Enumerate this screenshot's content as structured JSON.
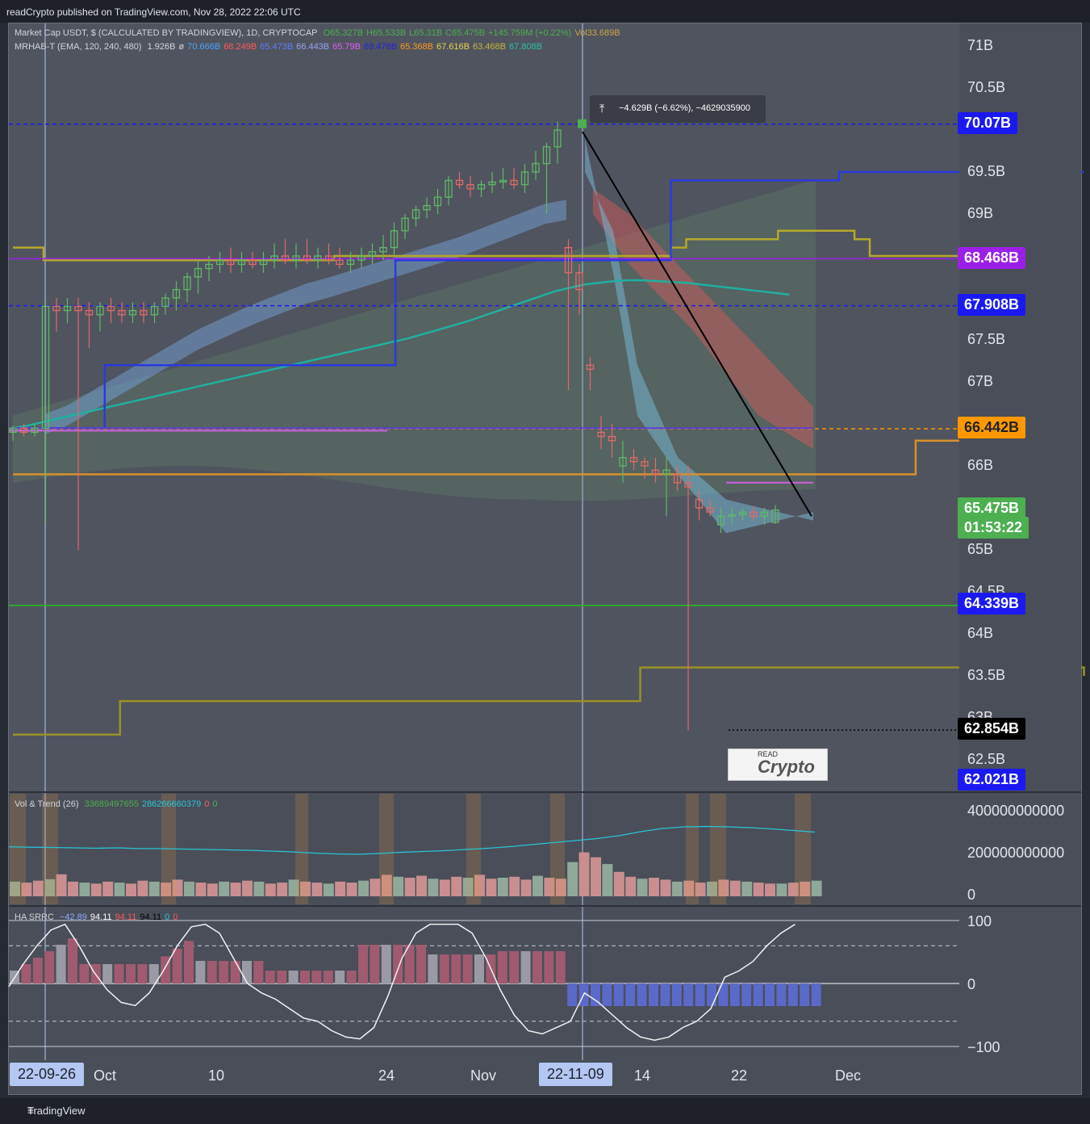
{
  "header": {
    "publisher": "readCrypto published on TradingView.com, Nov 28, 2022 22:06 UTC"
  },
  "legend": {
    "main": "Market Cap USDT, $ (CALCULATED BY TRADINGVIEW), 1D, CRYPTOCAP",
    "ohlc": [
      "O65.327B",
      "H65.533B",
      "L65.31B",
      "C65.475B",
      "+145.759M (+0.22%)",
      "Vol33.689B"
    ],
    "indicator": "MRHAB-T (EMA, 120, 240, 480)",
    "indicator_values": [
      "1.926B",
      "ø",
      "70.666B",
      "68.249B",
      "65.473B",
      "66.443B",
      "65.79B",
      "69.476B",
      "65.368B",
      "67.616B",
      "63.468B",
      "67.808B"
    ],
    "indicator_colors": [
      "#d1d4dc",
      "#d1d4dc",
      "#4aa3ff",
      "#ff5a5a",
      "#5b7fff",
      "#9aa0ff",
      "#e05cff",
      "#2222dd",
      "#ff9a1f",
      "#e8d34a",
      "#c8b43a",
      "#2bc0a0"
    ],
    "volume": "Vol & Trend (26)",
    "volume_values": [
      "33689497655",
      "286266660379",
      "0",
      "0"
    ],
    "hasrrc": "HA SRRC",
    "hasrrc_values": [
      "−42.89",
      "94.11",
      "94.11",
      "94.11",
      "0",
      "0"
    ]
  },
  "price_axis": {
    "ticks": [
      "71B",
      "70.5B",
      "69.5B",
      "69B",
      "67.5B",
      "67B",
      "66B",
      "65B",
      "64.5B",
      "64B",
      "63.5B",
      "63B",
      "62.5B"
    ],
    "badges": [
      {
        "label": "70.07B",
        "color": "#1a1af0",
        "text_color": "#ffffff"
      },
      {
        "label": "68.468B",
        "color": "#9c1fe8",
        "text_color": "#ffffff"
      },
      {
        "label": "67.908B",
        "color": "#1a1af0",
        "text_color": "#ffffff"
      },
      {
        "label": "66.442B",
        "color": "#ff9800",
        "text_color": "#1e2128"
      },
      {
        "label": "65.475B",
        "color": "#4caf50",
        "text_color": "#ffffff"
      },
      {
        "label": "01:53:22",
        "color": "#4caf50",
        "text_color": "#ffffff"
      },
      {
        "label": "64.339B",
        "color": "#1a1af0",
        "text_color": "#ffffff"
      },
      {
        "label": "62.854B",
        "color": "#000000",
        "text_color": "#ffffff"
      },
      {
        "label": "62.021B",
        "color": "#1a1af0",
        "text_color": "#ffffff"
      }
    ],
    "volume_ticks": [
      "400000000000",
      "200000000000",
      "0"
    ],
    "oscillator_ticks": [
      "100",
      "0",
      "−100"
    ]
  },
  "time_axis": {
    "labels": [
      "Oct",
      "10",
      "24",
      "Nov",
      "14",
      "22",
      "Dec"
    ],
    "highlighted": [
      "22-09-26",
      "22-11-09"
    ]
  },
  "measure_tool": {
    "label": "−4.629B (−6.62%), −4629035900",
    "icon": "ruler-icon"
  },
  "watermark": {
    "read": "READ",
    "crypto": "Crypto"
  },
  "footer": {
    "brand": "TradingView"
  },
  "chart_data": {
    "type": "candlestick",
    "ylim": [
      62.0,
      71.2
    ],
    "y_unit": "B",
    "start_date": "2022-09-22",
    "last_close": 65.475,
    "high_mark": 70.07,
    "low_mark": 62.854,
    "candles": [
      [
        66.4,
        66.48,
        66.3,
        66.45
      ],
      [
        66.45,
        66.5,
        66.35,
        66.4
      ],
      [
        66.4,
        66.5,
        66.35,
        66.45
      ],
      [
        66.45,
        67.95,
        65.3,
        67.9
      ],
      [
        67.9,
        68.0,
        67.6,
        67.85
      ],
      [
        67.85,
        68.0,
        67.7,
        67.9
      ],
      [
        67.9,
        68.0,
        65.0,
        67.85
      ],
      [
        67.85,
        67.95,
        67.4,
        67.8
      ],
      [
        67.8,
        67.95,
        67.6,
        67.9
      ],
      [
        67.9,
        68.0,
        67.7,
        67.85
      ],
      [
        67.85,
        67.95,
        67.7,
        67.8
      ],
      [
        67.8,
        67.95,
        67.7,
        67.85
      ],
      [
        67.85,
        67.95,
        67.7,
        67.8
      ],
      [
        67.8,
        67.95,
        67.7,
        67.9
      ],
      [
        67.9,
        68.05,
        67.8,
        68.0
      ],
      [
        68.0,
        68.2,
        67.85,
        68.1
      ],
      [
        68.1,
        68.3,
        67.95,
        68.25
      ],
      [
        68.25,
        68.45,
        68.05,
        68.35
      ],
      [
        68.35,
        68.5,
        68.2,
        68.4
      ],
      [
        68.4,
        68.55,
        68.3,
        68.45
      ],
      [
        68.45,
        68.6,
        68.3,
        68.4
      ],
      [
        68.4,
        68.55,
        68.3,
        68.45
      ],
      [
        68.45,
        68.55,
        68.35,
        68.4
      ],
      [
        68.4,
        68.55,
        68.3,
        68.45
      ],
      [
        68.45,
        68.65,
        68.35,
        68.5
      ],
      [
        68.5,
        68.7,
        68.4,
        68.45
      ],
      [
        68.45,
        68.65,
        68.35,
        68.5
      ],
      [
        68.5,
        68.7,
        68.4,
        68.45
      ],
      [
        68.45,
        68.6,
        68.35,
        68.5
      ],
      [
        68.5,
        68.65,
        68.4,
        68.45
      ],
      [
        68.45,
        68.6,
        68.35,
        68.4
      ],
      [
        68.4,
        68.55,
        68.3,
        68.45
      ],
      [
        68.45,
        68.6,
        68.35,
        68.5
      ],
      [
        68.5,
        68.65,
        68.4,
        68.55
      ],
      [
        68.55,
        68.75,
        68.45,
        68.6
      ],
      [
        68.6,
        68.9,
        68.5,
        68.8
      ],
      [
        68.8,
        69.0,
        68.7,
        68.95
      ],
      [
        68.95,
        69.1,
        68.85,
        69.05
      ],
      [
        69.05,
        69.2,
        68.95,
        69.1
      ],
      [
        69.1,
        69.3,
        69.0,
        69.2
      ],
      [
        69.2,
        69.45,
        69.1,
        69.4
      ],
      [
        69.4,
        69.5,
        69.3,
        69.35
      ],
      [
        69.35,
        69.45,
        69.2,
        69.3
      ],
      [
        69.3,
        69.4,
        69.2,
        69.35
      ],
      [
        69.35,
        69.5,
        69.25,
        69.38
      ],
      [
        69.38,
        69.55,
        69.3,
        69.4
      ],
      [
        69.4,
        69.55,
        69.3,
        69.35
      ],
      [
        69.35,
        69.6,
        69.25,
        69.5
      ],
      [
        69.5,
        69.75,
        69.4,
        69.6
      ],
      [
        69.6,
        69.85,
        69.0,
        69.8
      ],
      [
        69.8,
        70.1,
        69.6,
        70.0
      ],
      [
        68.6,
        68.7,
        66.9,
        68.3
      ],
      [
        68.3,
        68.4,
        67.8,
        68.1
      ],
      [
        67.2,
        67.3,
        66.9,
        67.15
      ],
      [
        66.4,
        66.6,
        66.2,
        66.35
      ],
      [
        66.35,
        66.5,
        66.1,
        66.3
      ],
      [
        66.0,
        66.3,
        65.8,
        66.1
      ],
      [
        66.1,
        66.2,
        65.95,
        66.05
      ],
      [
        66.05,
        66.1,
        65.85,
        66.0
      ],
      [
        65.95,
        66.1,
        65.8,
        65.9
      ],
      [
        65.9,
        66.1,
        65.4,
        65.95
      ],
      [
        65.9,
        66.0,
        65.7,
        65.8
      ],
      [
        65.8,
        66.0,
        62.85,
        65.75
      ],
      [
        65.6,
        65.7,
        65.35,
        65.5
      ],
      [
        65.5,
        65.6,
        65.4,
        65.45
      ],
      [
        65.3,
        65.5,
        65.2,
        65.4
      ],
      [
        65.4,
        65.5,
        65.3,
        65.42
      ],
      [
        65.42,
        65.5,
        65.35,
        65.45
      ],
      [
        65.45,
        65.52,
        65.35,
        65.4
      ],
      [
        65.4,
        65.5,
        65.3,
        65.45
      ],
      [
        65.327,
        65.533,
        65.31,
        65.475
      ]
    ],
    "ema_cyan": [
      66.45,
      66.48,
      66.52,
      66.56,
      66.6,
      66.64,
      66.68,
      66.72,
      66.76,
      66.8,
      66.84,
      66.88,
      66.92,
      66.96,
      67.0,
      67.04,
      67.08,
      67.12,
      67.16,
      67.2,
      67.24,
      67.28,
      67.32,
      67.36,
      67.4,
      67.44,
      67.48,
      67.52,
      67.57,
      67.62,
      67.67,
      67.72,
      67.78,
      67.84,
      67.9,
      67.96,
      68.02,
      68.08,
      68.12,
      68.16,
      68.18,
      68.2,
      68.21,
      68.21,
      68.2,
      68.19,
      68.18,
      68.16,
      68.14,
      68.12,
      68.1,
      68.08,
      68.06,
      68.04
    ],
    "ema_mid_band": [
      66.5,
      66.6,
      66.75,
      66.9,
      67.05,
      67.2,
      67.35,
      67.5,
      67.62,
      67.74,
      67.85,
      67.95,
      68.05,
      68.12,
      68.2,
      68.28,
      68.36,
      68.44,
      68.52,
      68.6,
      68.7,
      68.8,
      68.9,
      69.0,
      69.05
    ],
    "step_blue": [
      [
        0,
        66.45
      ],
      [
        5,
        66.45
      ],
      [
        6,
        67.2
      ],
      [
        24,
        67.2
      ],
      [
        25,
        68.45
      ],
      [
        42,
        68.45
      ],
      [
        43,
        69.4
      ],
      [
        53,
        69.4
      ],
      [
        54,
        69.5
      ],
      [
        70,
        69.5
      ]
    ],
    "step_olive_upper": [
      [
        0,
        68.6
      ],
      [
        2,
        68.45
      ],
      [
        20,
        68.45
      ],
      [
        21,
        68.5
      ],
      [
        43,
        68.6
      ],
      [
        44,
        68.7
      ],
      [
        50,
        68.8
      ],
      [
        55,
        68.7
      ],
      [
        56,
        68.5
      ],
      [
        62,
        68.5
      ],
      [
        63,
        68.2
      ],
      [
        68,
        68.2
      ],
      [
        69,
        67.6
      ]
    ],
    "step_olive_lower": [
      [
        0,
        62.8
      ],
      [
        6,
        62.8
      ],
      [
        7,
        63.2
      ],
      [
        40,
        63.2
      ],
      [
        41,
        63.6
      ],
      [
        68,
        63.6
      ],
      [
        70,
        63.5
      ]
    ],
    "step_orange": [
      [
        0,
        65.9
      ],
      [
        58,
        65.9
      ],
      [
        59,
        66.3
      ],
      [
        67,
        66.3
      ],
      [
        68,
        65.45
      ]
    ],
    "levels": [
      {
        "value": 70.07,
        "color": "#1a1af0",
        "style": "dashed"
      },
      {
        "value": 68.468,
        "color": "#9c1fe8",
        "style": "solid"
      },
      {
        "value": 67.908,
        "color": "#1a1af0",
        "style": "dashed"
      },
      {
        "value": 66.442,
        "color": "#ff9800",
        "style": "dashed"
      },
      {
        "value": 64.339,
        "color": "#22c322",
        "style": "solid"
      },
      {
        "value": 62.854,
        "color": "#000000",
        "style": "dotted"
      }
    ],
    "trend_line": {
      "from": [
        50,
        69.98
      ],
      "to": [
        70,
        65.4
      ],
      "color": "#000000"
    },
    "volume": [
      30,
      28,
      32,
      35,
      45,
      30,
      28,
      26,
      30,
      28,
      26,
      32,
      30,
      28,
      34,
      30,
      28,
      26,
      30,
      28,
      32,
      30,
      26,
      28,
      34,
      30,
      28,
      26,
      30,
      28,
      32,
      36,
      44,
      40,
      38,
      42,
      36,
      34,
      40,
      38,
      44,
      36,
      38,
      40,
      34,
      42,
      38,
      36,
      70,
      90,
      80,
      66,
      50,
      40,
      36,
      38,
      34,
      30,
      32,
      28,
      30,
      34,
      32,
      30,
      28,
      26,
      26,
      28,
      30,
      32
    ],
    "trend_line_vol": [
      245,
      243,
      242,
      240,
      238,
      240,
      236,
      236,
      234,
      232,
      230,
      228,
      224,
      220,
      214,
      210,
      208,
      212,
      218,
      222,
      226,
      232,
      238,
      246,
      256,
      266,
      276,
      286,
      300,
      320,
      336,
      344,
      346,
      344,
      340,
      334,
      326,
      318
    ],
    "oscillator_line": [
      -5,
      30,
      60,
      85,
      94,
      60,
      20,
      -10,
      -30,
      -35,
      -15,
      20,
      60,
      90,
      94,
      80,
      40,
      0,
      -15,
      -25,
      -40,
      -55,
      -60,
      -75,
      -85,
      -88,
      -70,
      -20,
      40,
      80,
      94,
      94,
      94,
      80,
      40,
      -10,
      -50,
      -75,
      -80,
      -70,
      -60,
      -15,
      -30,
      -50,
      -70,
      -85,
      -90,
      -85,
      -70,
      -60,
      -40,
      10,
      20,
      35,
      60,
      80,
      94
    ]
  }
}
